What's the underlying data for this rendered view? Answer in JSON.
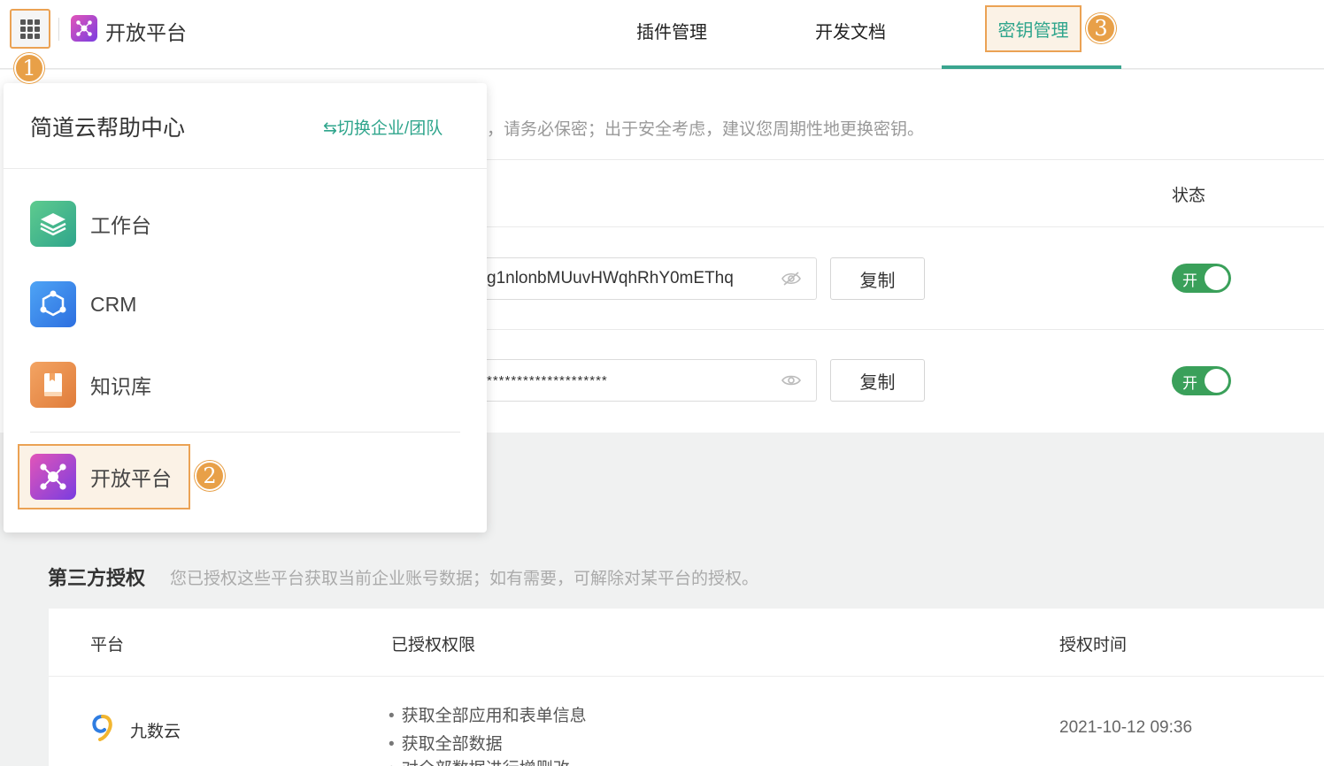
{
  "header": {
    "brand": "开放平台",
    "nav": [
      "插件管理",
      "开发文档",
      "密钥管理"
    ]
  },
  "markers": [
    "1",
    "2",
    "3"
  ],
  "secret_panel": {
    "tip": "，请务必保密；出于安全考虑，建议您周期性地更换密钥。",
    "status_header": "状态",
    "keys": [
      {
        "value": "g1nlonbMUuvHWqhRhY0mEThq",
        "copy": "复制",
        "status": "开"
      },
      {
        "value": "********************",
        "copy": "复制",
        "status": "开"
      }
    ]
  },
  "third_party": {
    "title": "第三方授权",
    "desc": "您已授权这些平台获取当前企业账号数据；如有需要，可解除对某平台的授权。",
    "headers": [
      "平台",
      "已授权权限",
      "授权时间"
    ],
    "rows": [
      {
        "platform": "九数云",
        "permissions": [
          "获取全部应用和表单信息",
          "获取全部数据",
          "对全部数据进行增删改"
        ],
        "time": "2021-10-12 09:36"
      }
    ]
  },
  "dropdown": {
    "title": "简道云帮助中心",
    "switch": "⇆切换企业/团队",
    "apps": [
      {
        "label": "工作台",
        "icon": "workbench-icon"
      },
      {
        "label": "CRM",
        "icon": "crm-icon"
      },
      {
        "label": "知识库",
        "icon": "knowledge-base-icon"
      },
      {
        "label": "开放平台",
        "icon": "open-platform-icon"
      }
    ]
  },
  "colors": {
    "accent": "#2fa58c",
    "highlight": "#eba254",
    "toggle_on": "#3aa05a"
  }
}
